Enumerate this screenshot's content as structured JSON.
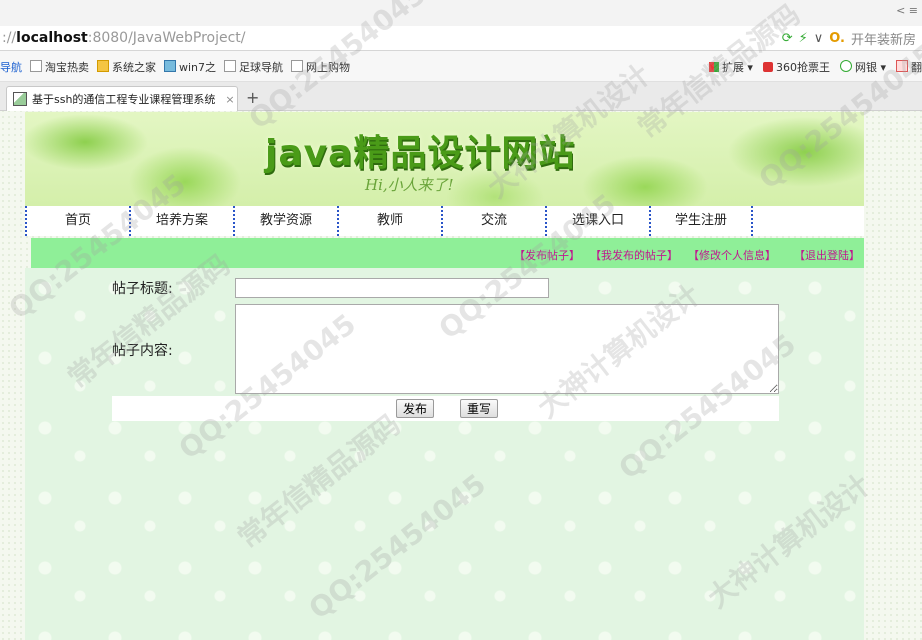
{
  "browser": {
    "url_prefix": "://",
    "url_host": "localhost",
    "url_path": ":8080/JavaWebProject/",
    "search_placeholder": "开年装新房",
    "bookmarks": [
      "导航",
      "淘宝热卖",
      "系统之家",
      "win7之",
      "足球导航",
      "网上购物"
    ],
    "toolbar_right": [
      "扩展",
      "360抢票王",
      "网银",
      "翻"
    ],
    "tab_title": "基于ssh的通信工程专业课程管理系统",
    "new_tab_symbol": "+"
  },
  "banner": {
    "title": "java精品设计网站",
    "subtitle": "Hi,小人来了!"
  },
  "nav": {
    "items": [
      "首页",
      "培养方案",
      "教学资源",
      "教师",
      "交流",
      "选课入口",
      "学生注册"
    ]
  },
  "actions": {
    "items": [
      "【发布帖子】",
      "【我发布的帖子】",
      "【修改个人信息】",
      "【退出登陆】"
    ]
  },
  "form": {
    "title_label": "帖子标题:",
    "title_value": "",
    "content_label": "帖子内容:",
    "content_value": "",
    "publish_label": "发布",
    "reset_label": "重写"
  },
  "watermark": {
    "lines": [
      "QQ:25454045",
      "常年信精品源码",
      "大神计算机设计"
    ]
  },
  "colors": {
    "action_bar": "#8fef98",
    "action_link": "#c0178f",
    "nav_divider": "#2a55c8",
    "content_bg": "#e2f5e2"
  }
}
